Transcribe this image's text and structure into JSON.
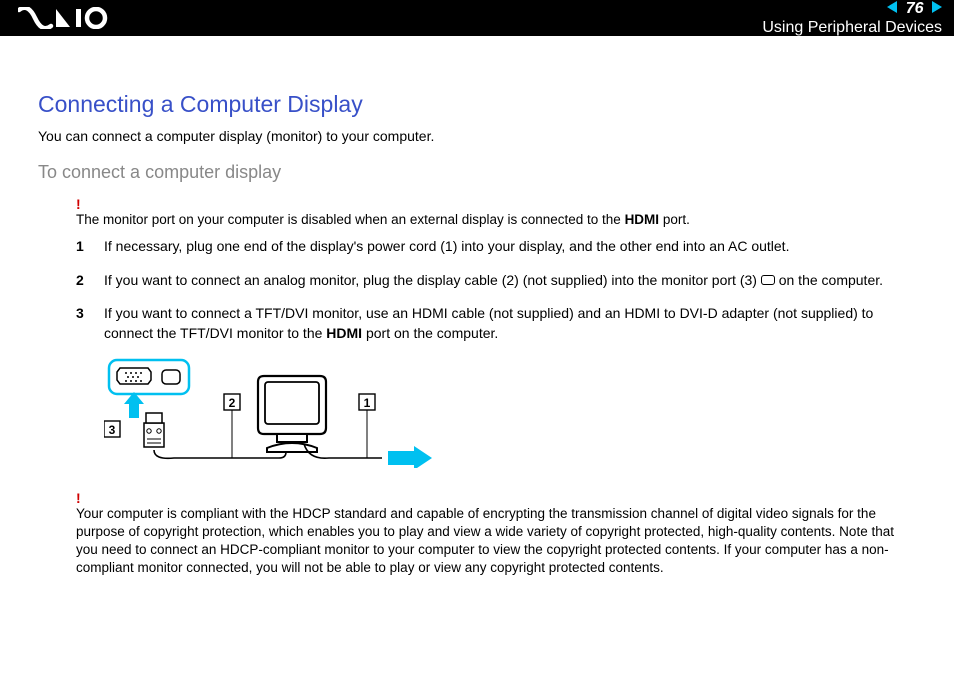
{
  "header": {
    "page_number": "76",
    "section": "Using Peripheral Devices"
  },
  "title": "Connecting a Computer Display",
  "intro": "You can connect a computer display (monitor) to your computer.",
  "subtitle": "To connect a computer display",
  "warning1": {
    "mark": "!",
    "pre": "The monitor port on your computer is disabled when an external display is connected to the ",
    "bold": "HDMI",
    "post": " port."
  },
  "steps": {
    "s1": "If necessary, plug one end of the display's power cord (1) into your display, and the other end into an AC outlet.",
    "s2_pre": "If you want to connect an analog monitor, plug the display cable (2) (not supplied) into the monitor port (3) ",
    "s2_post": " on the computer.",
    "s3_pre": "If you want to connect a TFT/DVI monitor, use an HDMI cable (not supplied) and an HDMI to DVI-D adapter (not supplied) to connect the TFT/DVI monitor to the ",
    "s3_bold": "HDMI",
    "s3_post": " port on the computer."
  },
  "warning2": {
    "mark": "!",
    "text": "Your computer is compliant with the HDCP standard and capable of encrypting the transmission channel of digital video signals for the purpose of copyright protection, which enables you to play and view a wide variety of copyright protected, high-quality contents. Note that you need to connect an HDCP-compliant monitor to your computer to view the copyright protected contents. If your computer has a non-compliant monitor connected, you will not be able to play or view any copyright protected contents."
  },
  "diagram_labels": {
    "l1": "1",
    "l2": "2",
    "l3": "3"
  }
}
